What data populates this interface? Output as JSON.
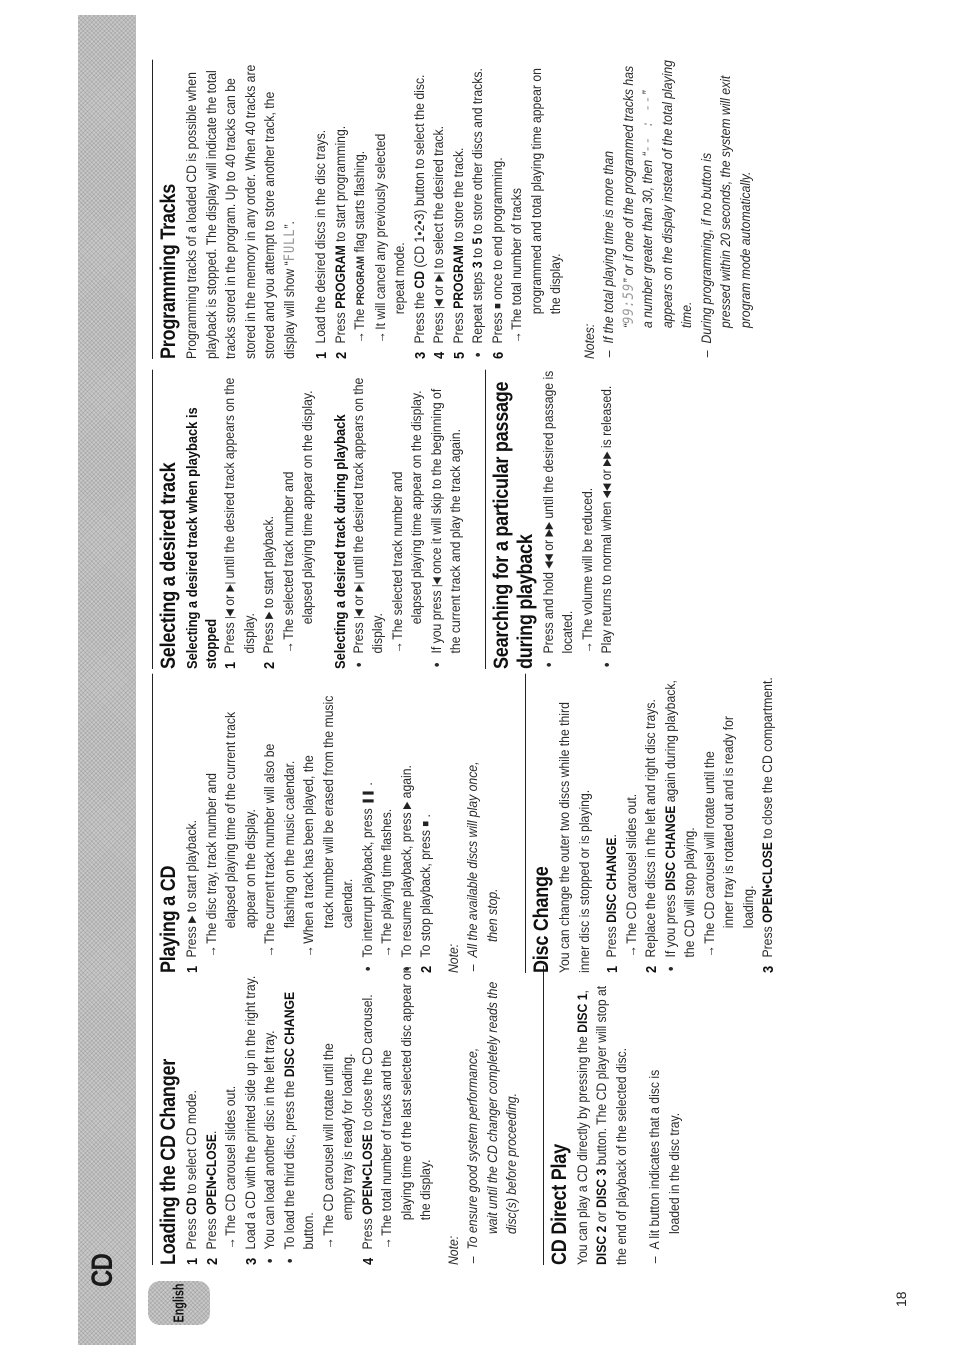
{
  "header": {
    "section_title": "CD",
    "language_tab": "English",
    "page_number": "18"
  },
  "icons": {
    "play": "▶",
    "pause": "❚❚",
    "stop": "■",
    "prev": "|◀",
    "next": "▶|",
    "rewind": "◀◀",
    "fast_forward": "▶▶"
  },
  "loading": {
    "title": "Loading the CD Changer",
    "step1": {
      "n": "1",
      "pre": "Press ",
      "bold": "CD",
      "post": " to select CD mode."
    },
    "step2": {
      "n": "2",
      "pre": "Press ",
      "bold": "OPEN•CLOSE",
      "post": "."
    },
    "step2_arrow": "The CD carousel slides out.",
    "step3": {
      "n": "3",
      "text": "Load a CD with the printed side up in the right tray."
    },
    "bullet1": "You can load another disc in the left tray.",
    "bullet2": {
      "pre": "To load the third disc, press the ",
      "bold": "DISC CHANGE",
      "post": " button."
    },
    "bullet2_arrow": {
      "first": "The CD carousel will rotate until the",
      "cont": "empty tray is ready for loading."
    },
    "step4": {
      "n": "4",
      "pre": "Press ",
      "bold": "OPEN•CLOSE",
      "post": " to close the CD carousel."
    },
    "step4_arrow": {
      "first": "The total number of tracks and the",
      "cont": "playing time of the last selected disc appear on the display."
    },
    "note_label": "Note:",
    "note": {
      "first": "To ensure good system performance,",
      "cont": "wait until the CD changer completely reads the disc(s) before proceeding."
    }
  },
  "direct": {
    "title": "CD Direct Play",
    "body": {
      "pre": "You can play a CD directly by pressing the ",
      "b1": "DISC 1",
      "mid1": ", ",
      "b2": "DISC 2",
      "mid2": " or ",
      "b3": "DISC 3",
      "post": " button. The CD player will stop at the end of playback of the selected disc."
    },
    "note": {
      "first": "A lit button indicates that a disc is",
      "cont": "loaded in the disc tray."
    }
  },
  "playing": {
    "title": "Playing a CD",
    "step1": {
      "n": "1",
      "pre": "Press ",
      "post": " to start playback."
    },
    "arrow1": {
      "first": "The disc tray, track number and",
      "cont": "elapsed playing time of the current track appear on the display."
    },
    "arrow2": {
      "first": "The current track number will also be",
      "cont": "flashing on the music calendar."
    },
    "arrow3": {
      "first": "When a track has been played, the",
      "cont": "track number will be erased from the music calendar."
    },
    "bullet_pause": {
      "pre": "To interrupt playback, press ",
      "post": " ."
    },
    "arrow_pause": "The playing time flashes.",
    "bullet_resume": {
      "pre": "To resume playback, press ",
      "post": " again."
    },
    "step2": {
      "n": "2",
      "pre": "To stop playback, press ",
      "post": " ."
    },
    "note_label": "Note:",
    "note": {
      "first": "All the available discs will play once,",
      "cont": "then stop."
    }
  },
  "disc_change": {
    "title": "Disc Change",
    "intro": "You can change the outer two discs while the third inner disc is stopped or is playing.",
    "step1": {
      "n": "1",
      "pre": "Press ",
      "bold": "DISC CHANGE",
      "post": "."
    },
    "step1_arrow": "The CD carousel slides out.",
    "step2": {
      "n": "2",
      "text": "Replace the discs in the left and right disc trays."
    },
    "bullet": {
      "pre": "If you press ",
      "bold": "DISC CHANGE",
      "post": " again during playback, the CD will stop playing."
    },
    "bullet_arrow": {
      "first": "The CD carousel will rotate until the",
      "cont": "inner tray is rotated out and is ready for loading."
    },
    "step3": {
      "n": "3",
      "pre": "Press ",
      "bold": "OPEN•CLOSE",
      "post": " to close the CD compartment."
    }
  },
  "selecting": {
    "title": "Selecting a desired track",
    "sub1": "Selecting a desired track when playback is stopped",
    "s1_step1": {
      "n": "1",
      "pre": "Press ",
      "mid": " or ",
      "post": " until the desired track appears on the display."
    },
    "s1_step2": {
      "n": "2",
      "pre": "Press ",
      "post": " to start playback."
    },
    "s1_arrow": {
      "first": "The selected track number and",
      "cont": "elapsed playing time appear on the display."
    },
    "sub2": "Selecting a desired track during playback",
    "s2_bullet1": {
      "pre": "Press ",
      "mid": " or ",
      "post": " until the desired track appears on the display."
    },
    "s2_arrow": {
      "first": "The selected track number and",
      "cont": "elapsed playing time appear on the display."
    },
    "s2_bullet2": {
      "pre": "If you press ",
      "post": " once it will skip to the beginning of the current track and play the track again."
    }
  },
  "searching": {
    "title": "Searching for a particular passage during playback",
    "bullet1": {
      "pre": "Press and hold ",
      "mid": " or ",
      "post": " until the desired passage is located."
    },
    "arrow": "The volume will be reduced.",
    "bullet2": {
      "pre": "Play returns to normal when ",
      "mid": " or ",
      "post": " is released."
    }
  },
  "programming": {
    "title": "Programming Tracks",
    "intro_pre": "Programming tracks of a loaded CD is possible when playback is stopped. The display will indicate the total tracks stored in the program. Up to 40 tracks can be stored in the memory in any order. When 40 tracks are stored and you attempt to store another track, the display will show “",
    "intro_lcd": "FULL",
    "intro_post": "”.",
    "step1": {
      "n": "1",
      "text": "Load the desired discs in the disc trays."
    },
    "step2": {
      "n": "2",
      "pre": "Press ",
      "bold": "PROGRAM",
      "post": " to start programming."
    },
    "arrow1": {
      "pre": "The ",
      "small": "PROGRAM",
      "post": " flag starts flashing."
    },
    "arrow2": {
      "first": "It will cancel any previously selected",
      "cont": "repeat mode."
    },
    "step3": {
      "n": "3",
      "pre": "Press the ",
      "bold": "CD",
      "post": " (CD 1•2•3) button to select the disc."
    },
    "step4": {
      "n": "4",
      "pre": "Press ",
      "mid": " or ",
      "post": " to select the desired track."
    },
    "step5": {
      "n": "5",
      "pre": "Press ",
      "bold": "PROGRAM",
      "post": " to store the track."
    },
    "bullet": {
      "pre": "Repeat steps ",
      "b1": "3",
      "mid": " to ",
      "b2": "5",
      "post": " to store other discs and tracks."
    },
    "step6": {
      "n": "6",
      "pre": "Press ",
      "post": " once to end programming."
    },
    "arrow3": {
      "first": "The total number of tracks",
      "cont": "programmed and total playing time appear on the display."
    },
    "notes_label": "Notes:",
    "note1": {
      "first_pre": "If the total playing time is more than",
      "cont_pre": "“",
      "lcd1": "99:59",
      "cont_post": "” or if one of the programmed tracks has a number greater than 30, then “",
      "lcd2": "-- : --",
      "cont_end": "” appears on the display instead of the total playing time."
    },
    "note2": {
      "first": "During programming,  if no button is",
      "cont": "pressed within 20 seconds, the system will exit program mode automatically."
    }
  }
}
